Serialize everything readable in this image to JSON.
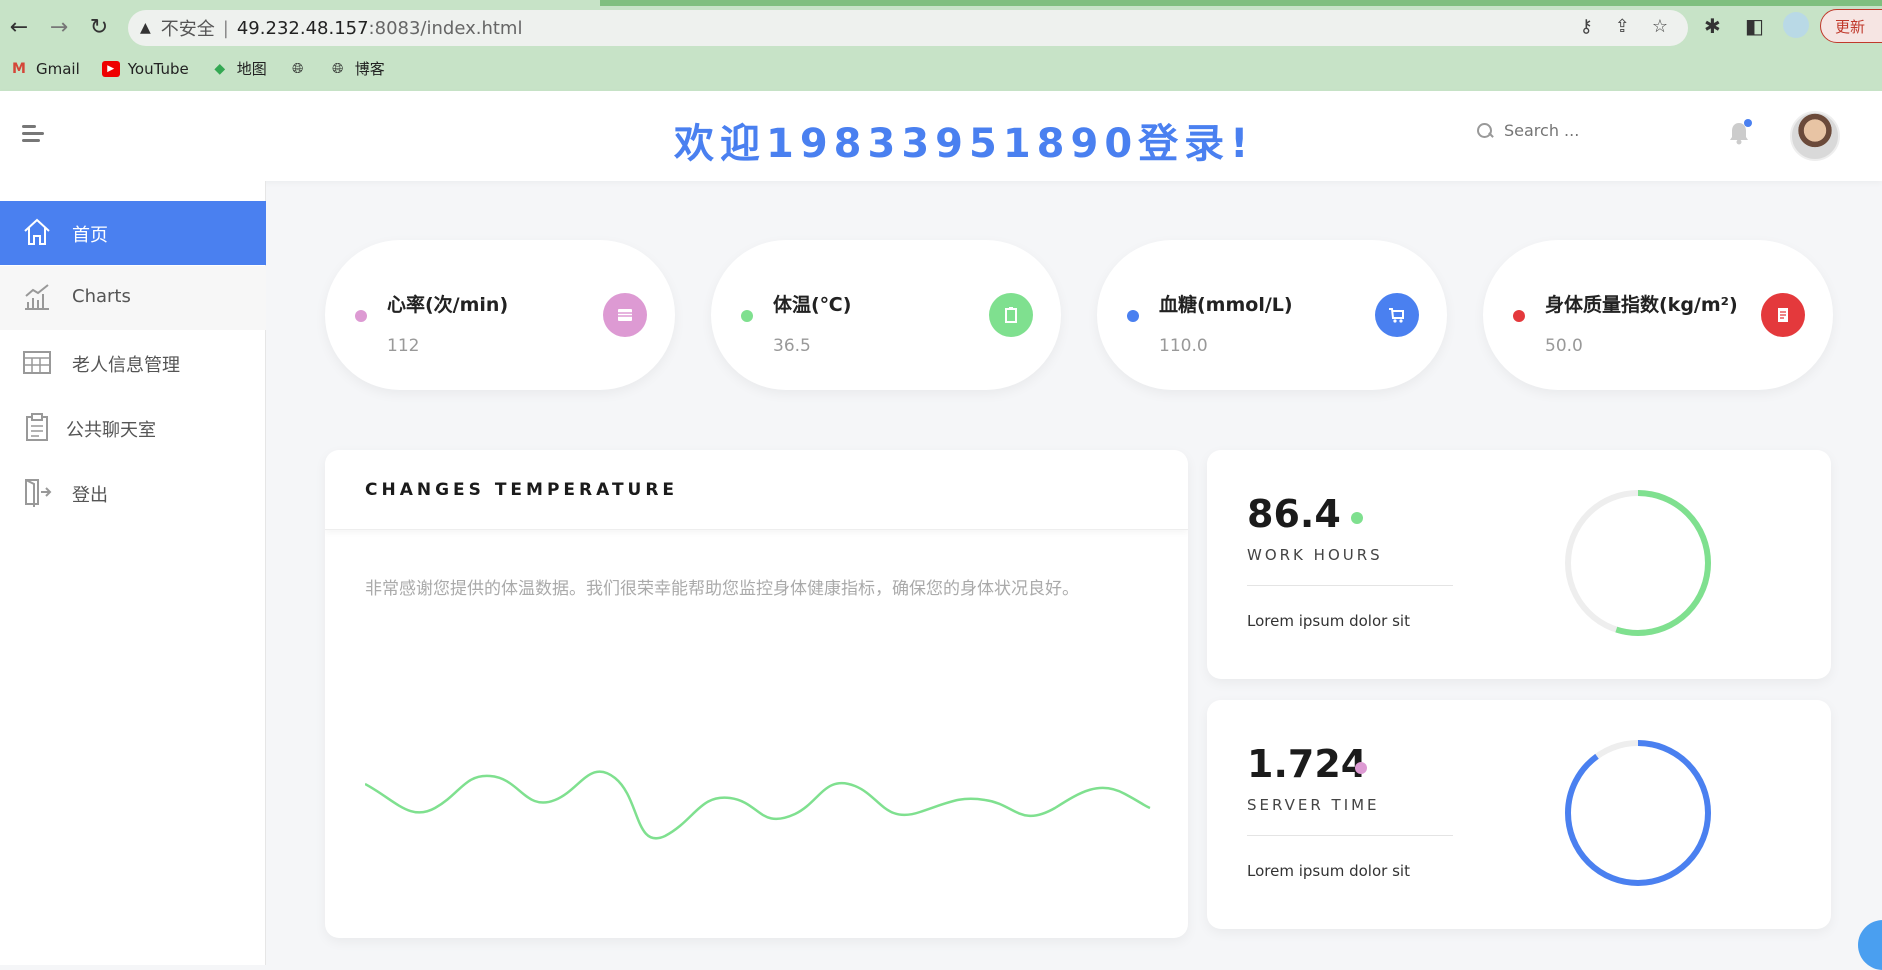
{
  "browser": {
    "insecure_label": "不安全",
    "url_host": "49.232.48.157",
    "url_rest": ":8083/index.html",
    "update_label": "更新",
    "bookmarks": [
      {
        "label": "Gmail",
        "icon": "gmail-icon"
      },
      {
        "label": "YouTube",
        "icon": "youtube-icon"
      },
      {
        "label": "地图",
        "icon": "maps-icon"
      },
      {
        "label": "",
        "icon": "globe-icon"
      },
      {
        "label": "博客",
        "icon": "globe-icon"
      }
    ]
  },
  "header": {
    "welcome": "欢迎19833951890登录!",
    "search_placeholder": "Search ..."
  },
  "sidebar": {
    "items": [
      {
        "label": "首页",
        "icon": "home-icon",
        "active": true
      },
      {
        "label": "Charts",
        "icon": "chart-icon"
      },
      {
        "label": "老人信息管理",
        "icon": "table-icon"
      },
      {
        "label": "公共聊天室",
        "icon": "clipboard-icon"
      },
      {
        "label": "登出",
        "icon": "logout-icon"
      }
    ]
  },
  "stats": [
    {
      "title": "心率(次/min)",
      "value": "112",
      "dot_color": "#dd9ad3",
      "badge_color": "#dd9ad3",
      "icon": "card-icon"
    },
    {
      "title": "体温(℃)",
      "value": "36.5",
      "dot_color": "#7fe08f",
      "badge_color": "#7fe08f",
      "icon": "clipboard-icon"
    },
    {
      "title": "血糖(mmol/L)",
      "value": "110.0",
      "dot_color": "#4a80f0",
      "badge_color": "#4a80f0",
      "icon": "cart-icon"
    },
    {
      "title": "身体质量指数(kg/m²)",
      "value": "50.0",
      "dot_color": "#e4393c",
      "badge_color": "#e4393c",
      "icon": "receipt-icon"
    }
  ],
  "temperature_card": {
    "title": "CHANGES TEMPERATURE",
    "description": "非常感谢您提供的体温数据。我们很荣幸能帮助您监控身体健康指标，确保您的身体状况良好。",
    "line_color": "#7fe08f"
  },
  "rings": [
    {
      "value": "86.4",
      "label": "WORK HOURS",
      "text": "Lorem ipsum dolor sit",
      "dot_color": "#7fe08f",
      "ring_color": "#7fe08f",
      "fraction": 0.55
    },
    {
      "value": "1.724",
      "label": "SERVER TIME",
      "text": "Lorem ipsum dolor sit",
      "dot_color": "#dd9ad3",
      "ring_color": "#4a80f0",
      "fraction": 0.9
    }
  ]
}
